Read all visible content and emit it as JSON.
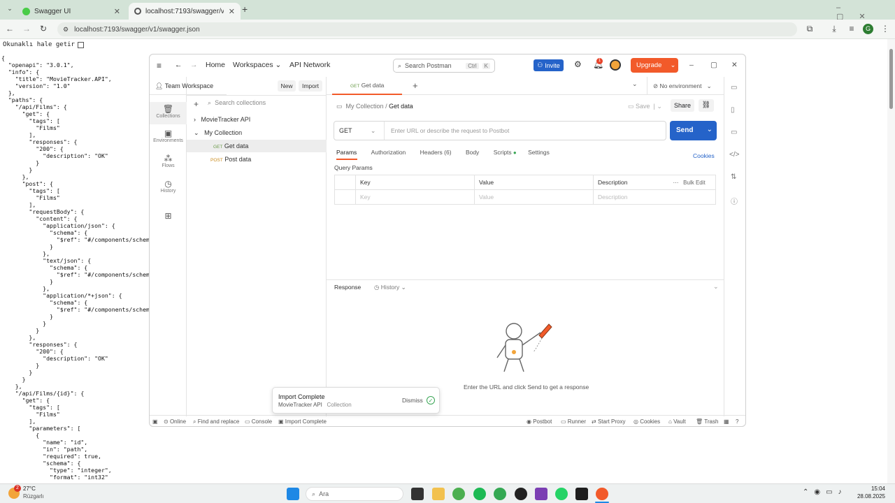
{
  "browser": {
    "tabs": [
      {
        "title": "Swagger UI"
      },
      {
        "title": "localhost:7193/swagger/v1/swa"
      }
    ],
    "url": "localhost:7193/swagger/v1/swagger.json",
    "profile_initial": "G"
  },
  "page": {
    "raw_label": "Okunaklı hale getir",
    "json_text": "{\n  \"openapi\": \"3.0.1\",\n  \"info\": {\n    \"title\": \"MovieTracker.API\",\n    \"version\": \"1.0\"\n  },\n  \"paths\": {\n    \"/api/Films\": {\n      \"get\": {\n        \"tags\": [\n          \"Films\"\n        ],\n        \"responses\": {\n          \"200\": {\n            \"description\": \"OK\"\n          }\n        }\n      },\n      \"post\": {\n        \"tags\": [\n          \"Films\"\n        ],\n        \"requestBody\": {\n          \"content\": {\n            \"application/json\": {\n              \"schema\": {\n                \"$ref\": \"#/components/schemas/\n              }\n            },\n            \"text/json\": {\n              \"schema\": {\n                \"$ref\": \"#/components/schemas/\n              }\n            },\n            \"application/*+json\": {\n              \"schema\": {\n                \"$ref\": \"#/components/schemas/\n              }\n            }\n          }\n        },\n        \"responses\": {\n          \"200\": {\n            \"description\": \"OK\"\n          }\n        }\n      }\n    },\n    \"/api/Films/{id}\": {\n      \"get\": {\n        \"tags\": [\n          \"Films\"\n        ],\n        \"parameters\": [\n          {\n            \"name\": \"id\",\n            \"in\": \"path\",\n            \"required\": true,\n            \"schema\": {\n              \"type\": \"integer\",\n              \"format\": \"int32\""
  },
  "postman": {
    "nav": {
      "home": "Home",
      "workspaces": "Workspaces",
      "api_network": "API Network"
    },
    "search": {
      "placeholder": "Search Postman",
      "shortcut_ctrl": "Ctrl",
      "shortcut_k": "K"
    },
    "invite": "Invite",
    "notification_count": "1",
    "upgrade": "Upgrade",
    "workspace": {
      "name": "Team Workspace",
      "new": "New",
      "import": "Import"
    },
    "sidebar": {
      "collections": "Collections",
      "environments": "Environments",
      "flows": "Flows",
      "history": "History"
    },
    "collections": {
      "search_placeholder": "Search collections",
      "items": [
        {
          "name": "MovieTracker API"
        },
        {
          "name": "My Collection"
        }
      ],
      "requests": [
        {
          "method": "GET",
          "name": "Get data"
        },
        {
          "method": "POST",
          "name": "Post data"
        }
      ]
    },
    "tab": {
      "method": "GET",
      "name": "Get data"
    },
    "environment": "No environment",
    "breadcrumb": {
      "collection": "My Collection",
      "separator": "/",
      "request": "Get data"
    },
    "actions": {
      "save": "Save",
      "share": "Share"
    },
    "request": {
      "method": "GET",
      "url_placeholder": "Enter URL or describe the request to Postbot",
      "send": "Send"
    },
    "request_tabs": [
      "Params",
      "Authorization",
      "Headers (6)",
      "Body",
      "Scripts",
      "Settings"
    ],
    "cookies": "Cookies",
    "query_params": {
      "title": "Query Params",
      "headers": [
        "Key",
        "Value",
        "Description"
      ],
      "bulk_edit": "Bulk Edit",
      "placeholders": [
        "Key",
        "Value",
        "Description"
      ]
    },
    "response": {
      "title": "Response",
      "history": "History",
      "empty_text": "Enter the URL and click Send to get a response"
    },
    "toast": {
      "title": "Import Complete",
      "item": "MovieTracker API",
      "item_type": "Collection",
      "dismiss": "Dismiss"
    },
    "footer": {
      "online": "Online",
      "find_replace": "Find and replace",
      "console": "Console",
      "import_complete": "Import Complete",
      "postbot": "Postbot",
      "runner": "Runner",
      "start_proxy": "Start Proxy",
      "cookies": "Cookies",
      "vault": "Vault",
      "trash": "Trash"
    }
  },
  "taskbar": {
    "weather_temp": "27°C",
    "weather_desc": "Rüzgarlı",
    "weather_badge": "2",
    "search_placeholder": "Ara",
    "time": "15:04",
    "date": "28.08.2025"
  },
  "colors": {
    "accent": "#2563c9",
    "upgrade": "#f25a2a",
    "get": "#6b9b4a",
    "post": "#c98a1b"
  }
}
